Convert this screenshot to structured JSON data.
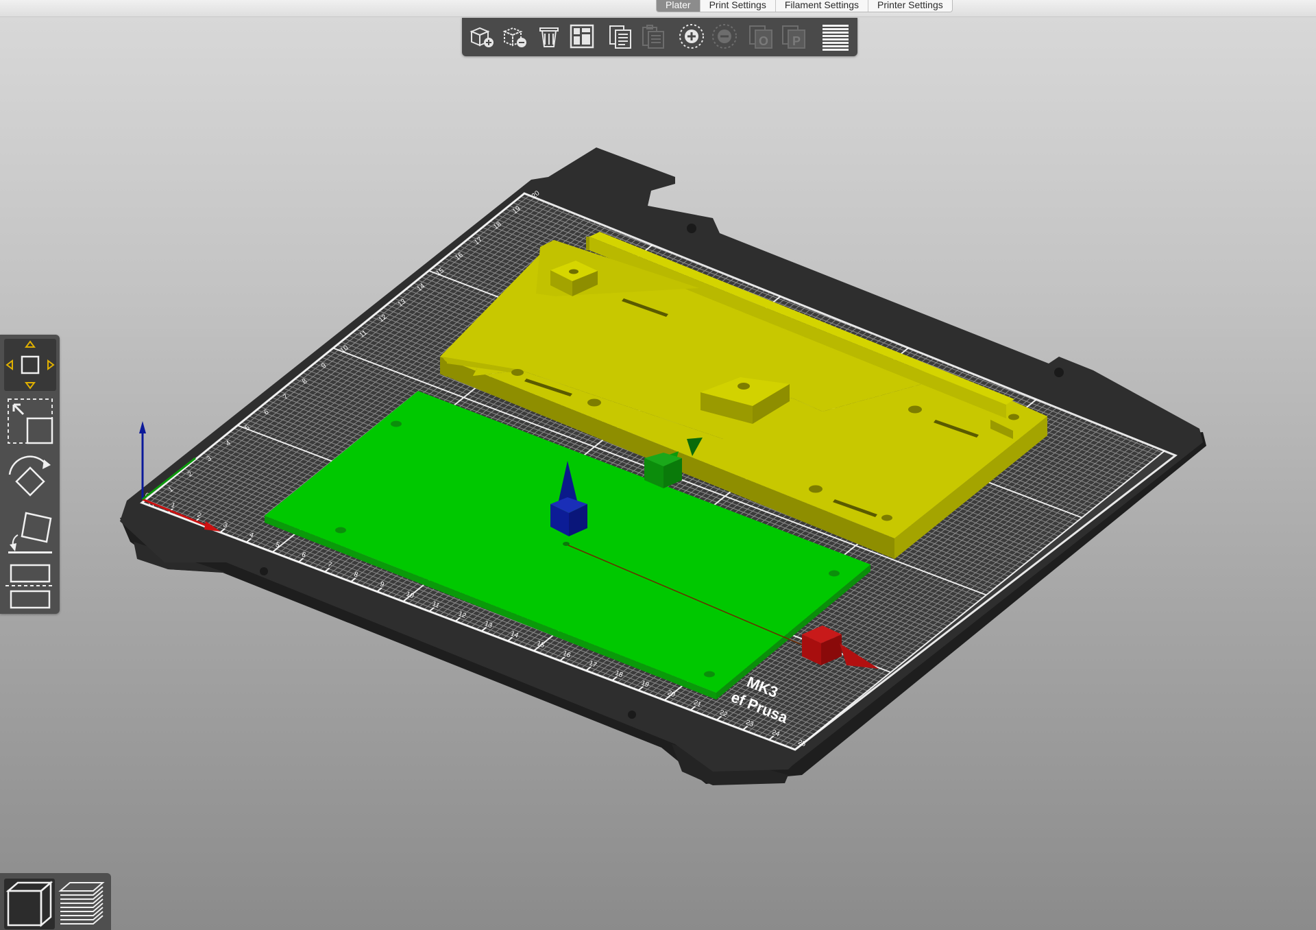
{
  "tabs": [
    {
      "label": "Plater",
      "active": true
    },
    {
      "label": "Print Settings",
      "active": false
    },
    {
      "label": "Filament Settings",
      "active": false
    },
    {
      "label": "Printer Settings",
      "active": false
    }
  ],
  "toolbar": {
    "buttons": [
      {
        "icon": "add-object-icon",
        "enabled": true
      },
      {
        "icon": "delete-object-icon",
        "enabled": true
      },
      {
        "icon": "delete-all-icon",
        "enabled": true
      },
      {
        "icon": "arrange-icon",
        "enabled": true
      },
      {
        "icon": "copy-icon",
        "enabled": true
      },
      {
        "icon": "paste-icon",
        "enabled": false
      },
      {
        "icon": "add-instance-icon",
        "enabled": true
      },
      {
        "icon": "remove-instance-icon",
        "enabled": false
      },
      {
        "icon": "split-to-objects-icon",
        "enabled": false
      },
      {
        "icon": "split-to-parts-icon",
        "enabled": false
      },
      {
        "icon": "layers-editing-icon",
        "enabled": true
      }
    ],
    "split_objects_letter": "O",
    "split_parts_letter": "P"
  },
  "bed": {
    "logo_line1": "MK3",
    "logo_line2": "ef Prusa",
    "x_ticks": [
      "0",
      "1",
      "2",
      "3",
      "4",
      "5",
      "6",
      "7",
      "8",
      "9",
      "10",
      "11",
      "12",
      "13",
      "14",
      "15",
      "16",
      "17",
      "18",
      "19",
      "20",
      "21",
      "22",
      "23",
      "24",
      "25"
    ],
    "y_ticks": [
      "0",
      "1",
      "2",
      "3",
      "4",
      "5",
      "6",
      "7",
      "8",
      "9",
      "10",
      "11",
      "12",
      "13",
      "14",
      "15",
      "16",
      "17",
      "18",
      "19",
      "20"
    ]
  },
  "objects": [
    {
      "name": "yellow-enclosure-base",
      "color": "#c8c800"
    },
    {
      "name": "green-plate",
      "color": "#00c800",
      "selected": true
    }
  ],
  "colors": {
    "axis_x": "#cc1111",
    "axis_y": "#0c9a0c",
    "axis_z": "#0c1a9a",
    "gizmo_accent": "#e0b000",
    "bed_dark": "#2e2e2e"
  },
  "gizmos": [
    {
      "icon": "move-gizmo-icon",
      "active": true
    },
    {
      "icon": "scale-gizmo-icon",
      "active": false
    },
    {
      "icon": "rotate-gizmo-icon",
      "active": false
    },
    {
      "icon": "place-on-face-icon",
      "active": false
    },
    {
      "icon": "cut-gizmo-icon",
      "active": false
    }
  ],
  "view_toggle": [
    {
      "icon": "3d-view-icon",
      "active": true
    },
    {
      "icon": "preview-layers-icon",
      "active": false
    }
  ]
}
